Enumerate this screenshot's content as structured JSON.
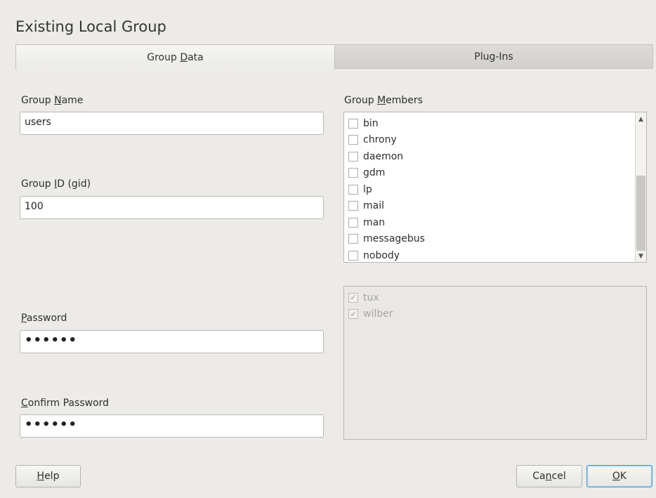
{
  "dialog": {
    "title": "Existing Local Group"
  },
  "tabs": [
    {
      "pre": "Group ",
      "mnemonic": "D",
      "post": "ata"
    },
    {
      "pre": "Plu",
      "mnemonic": "g",
      "post": "-Ins"
    }
  ],
  "group_name": {
    "label_pre": "Group ",
    "label_mnemonic": "N",
    "label_post": "ame",
    "value": "users"
  },
  "group_id": {
    "label_pre": "Group ",
    "label_mnemonic": "I",
    "label_post": "D (gid)",
    "value": "100"
  },
  "password": {
    "label_pre": "",
    "label_mnemonic": "P",
    "label_post": "assword",
    "value": "••••••"
  },
  "confirm_password": {
    "label_pre": "",
    "label_mnemonic": "C",
    "label_post": "onfirm Password",
    "value": "••••••"
  },
  "members": {
    "label_pre": "Group ",
    "label_mnemonic": "M",
    "label_post": "embers",
    "items": [
      "bin",
      "chrony",
      "daemon",
      "gdm",
      "lp",
      "mail",
      "man",
      "messagebus",
      "nobody"
    ]
  },
  "default_members": {
    "items": [
      {
        "label": "tux",
        "checked": "✓"
      },
      {
        "label": "wilber",
        "checked": "✓"
      }
    ]
  },
  "buttons": {
    "help": {
      "pre": "",
      "mnemonic": "H",
      "post": "elp"
    },
    "cancel": {
      "pre": "Ca",
      "mnemonic": "n",
      "post": "cel"
    },
    "ok": {
      "pre": "",
      "mnemonic": "O",
      "post": "K"
    }
  },
  "colors": {
    "background": "#ecebe7",
    "ok_focus_border": "#4d9fd6"
  }
}
